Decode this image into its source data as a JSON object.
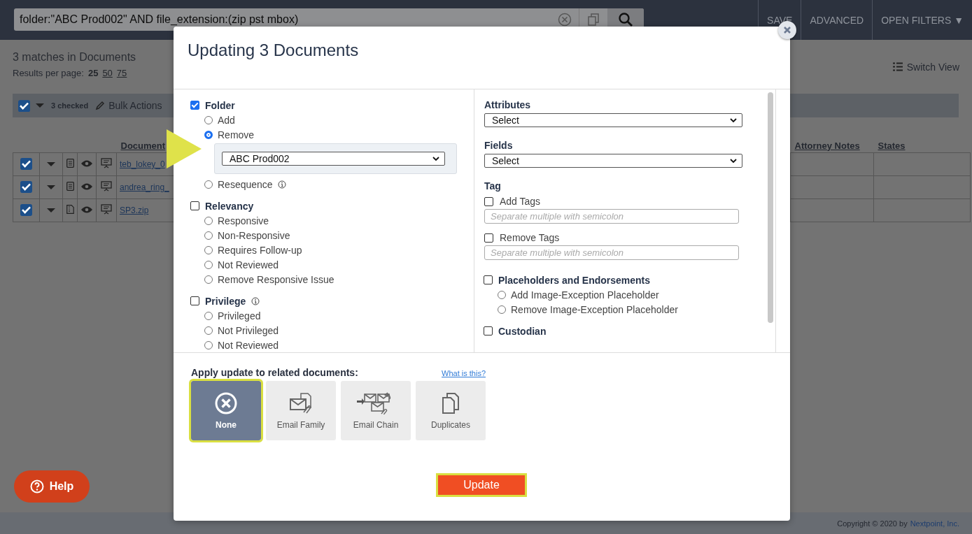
{
  "search": {
    "value": "folder:\"ABC Prod002\" AND file_extension:(zip pst mbox)"
  },
  "top_actions": [
    "SAVE",
    "ADVANCED",
    "OPEN FILTERS ▼"
  ],
  "results": {
    "summary": "3 matches in Documents",
    "per_page_label": "Results per page:",
    "per_page_options": [
      {
        "label": "25",
        "selected": true
      },
      {
        "label": "50",
        "selected": false
      },
      {
        "label": "75",
        "selected": false
      }
    ]
  },
  "switch_view": "Switch View",
  "toolbar": {
    "all_checked": true,
    "checked_count": "3 checked",
    "bulk_actions": "Bulk Actions"
  },
  "table": {
    "columns": [
      "Document",
      "Attorney Notes",
      "States"
    ],
    "rows": [
      {
        "checked": true,
        "kind": "text",
        "name": "teb_lokey_0"
      },
      {
        "checked": true,
        "kind": "text",
        "name": "andrea_ring_"
      },
      {
        "checked": true,
        "kind": "archive",
        "name": "SP3.zip"
      }
    ]
  },
  "help": "Help",
  "footer": {
    "copyright": "Copyright © 2020 by",
    "company": "Nextpoint, Inc."
  },
  "modal": {
    "title": "Updating 3 Documents",
    "left_sections": [
      {
        "label": "Folder",
        "checked": true,
        "options": [
          {
            "label": "Add",
            "selected": false
          },
          {
            "label": "Remove",
            "selected": true,
            "dropdown": "ABC Prod002"
          },
          {
            "label": "Resequence",
            "selected": false,
            "info": true
          }
        ]
      },
      {
        "label": "Relevancy",
        "checked": false,
        "options": [
          {
            "label": "Responsive",
            "selected": false
          },
          {
            "label": "Non-Responsive",
            "selected": false
          },
          {
            "label": "Requires Follow-up",
            "selected": false
          },
          {
            "label": "Not Reviewed",
            "selected": false
          },
          {
            "label": "Remove Responsive Issue",
            "selected": false
          }
        ]
      },
      {
        "label": "Privilege",
        "checked": false,
        "info": true,
        "options": [
          {
            "label": "Privileged",
            "selected": false
          },
          {
            "label": "Not Privileged",
            "selected": false
          },
          {
            "label": "Not Reviewed",
            "selected": false
          }
        ]
      }
    ],
    "right_sections": [
      {
        "kind": "select",
        "label": "Attributes",
        "value": "Select"
      },
      {
        "kind": "select",
        "label": "Fields",
        "value": "Select"
      },
      {
        "kind": "tags",
        "label": "Tag",
        "items": [
          {
            "label": "Add Tags",
            "checked": false,
            "placeholder": "Separate multiple with semicolon"
          },
          {
            "label": "Remove Tags",
            "checked": false,
            "placeholder": "Separate multiple with semicolon"
          }
        ]
      },
      {
        "kind": "checkgroup",
        "label": "Placeholders and Endorsements",
        "checked": false,
        "options": [
          {
            "label": "Add Image-Exception Placeholder",
            "selected": false
          },
          {
            "label": "Remove Image-Exception Placeholder",
            "selected": false
          }
        ]
      },
      {
        "kind": "checkgroup",
        "label": "Custodian",
        "checked": false
      }
    ],
    "related": {
      "label": "Apply update to related documents:",
      "link": "What is this?",
      "options": [
        {
          "kind": "none",
          "label": "None",
          "selected": true
        },
        {
          "kind": "email_family",
          "label": "Email Family",
          "selected": false
        },
        {
          "kind": "email_chain",
          "label": "Email Chain",
          "selected": false
        },
        {
          "kind": "duplicates",
          "label": "Duplicates",
          "selected": false
        }
      ]
    },
    "submit": "Update"
  }
}
